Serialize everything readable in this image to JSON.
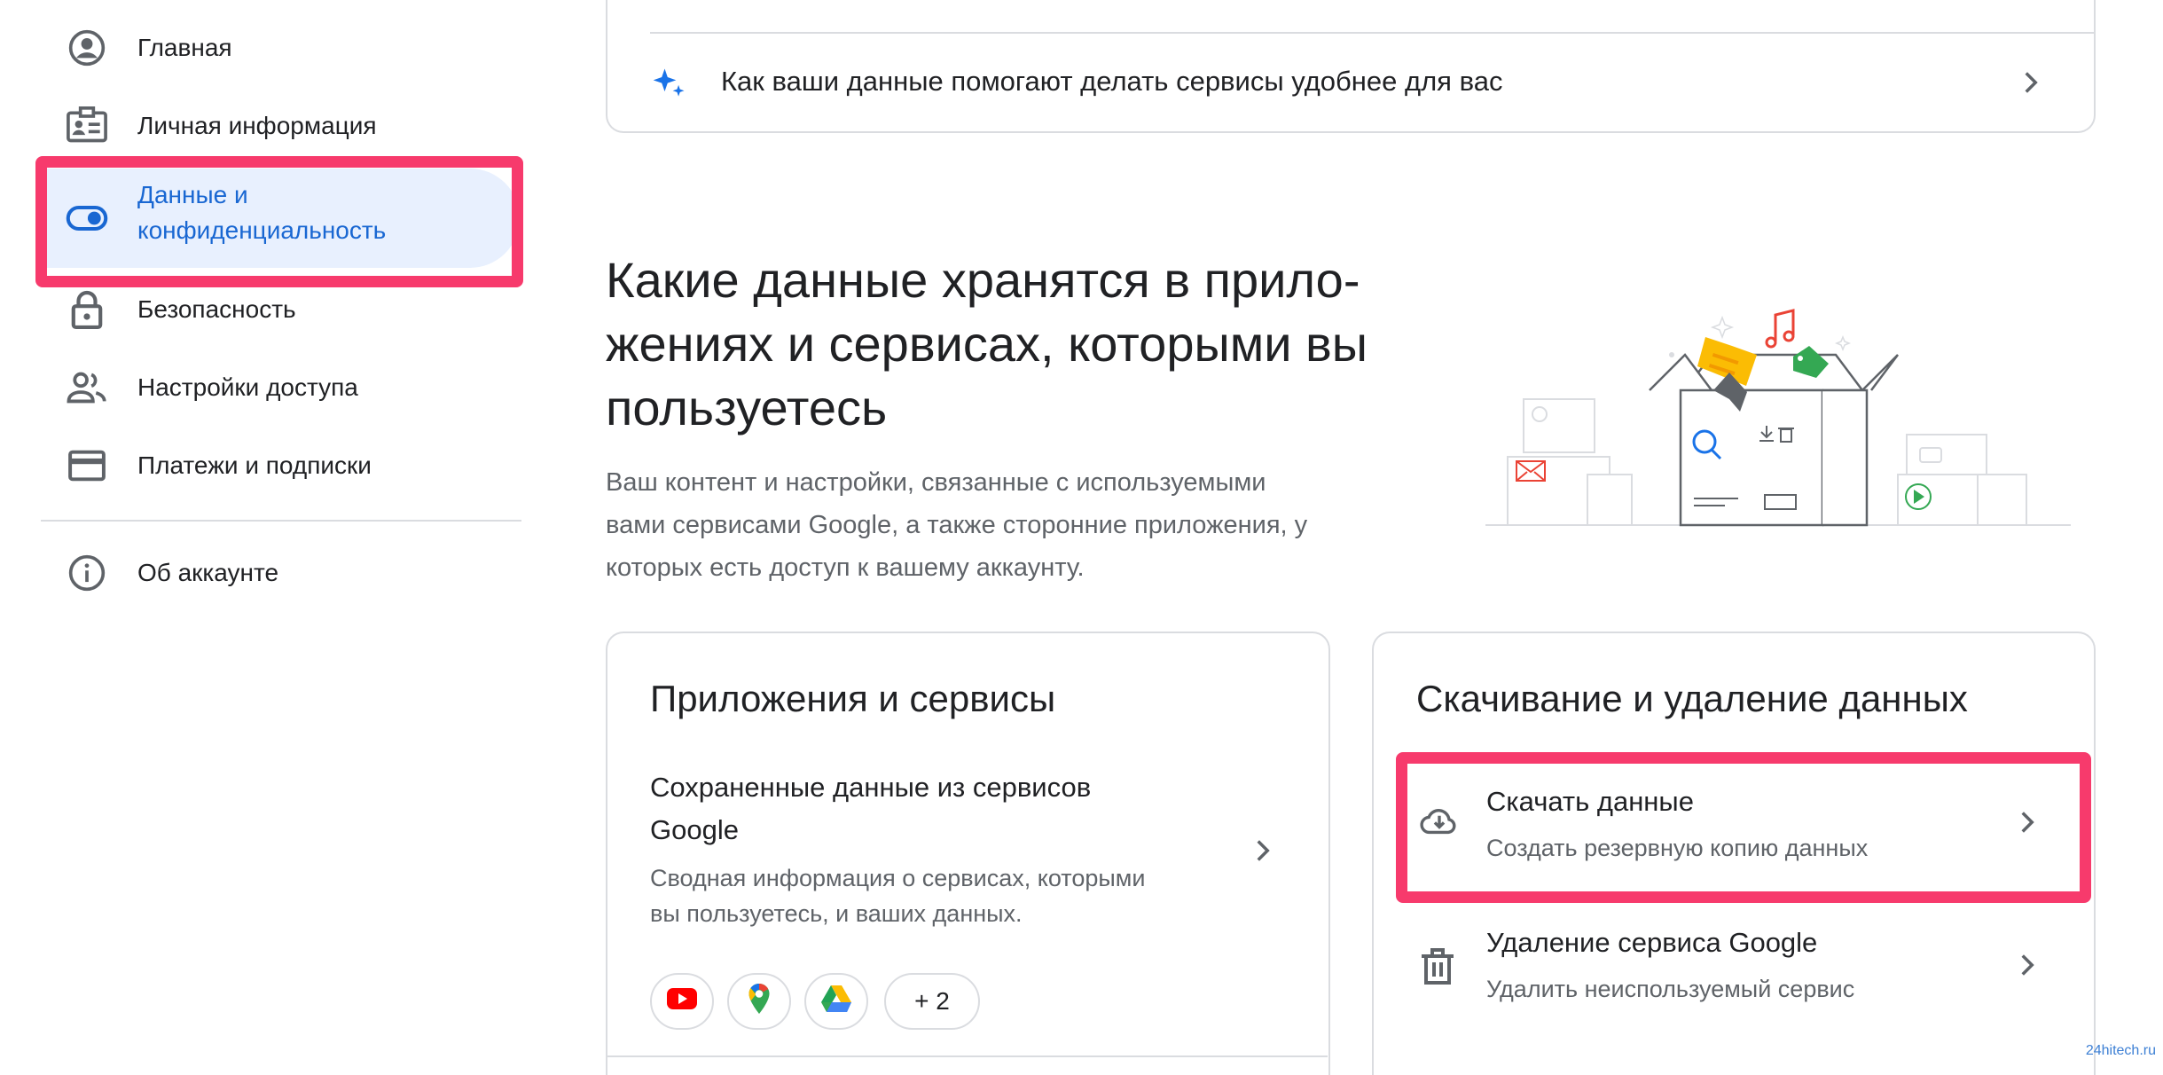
{
  "sidebar": {
    "items": [
      {
        "label": "Главная",
        "icon": "account-circle-icon"
      },
      {
        "label": "Личная информация",
        "icon": "badge-icon"
      },
      {
        "label": "Данные и конфиденциальность",
        "label_line1": "Данные и",
        "label_line2": "конфиденциальность",
        "icon": "toggle-icon",
        "active": true
      },
      {
        "label": "Безопасность",
        "icon": "lock-icon"
      },
      {
        "label": "Настройки доступа",
        "icon": "people-icon"
      },
      {
        "label": "Платежи и подписки",
        "icon": "credit-card-icon"
      }
    ],
    "about": {
      "label": "Об аккаунте",
      "icon": "info-icon"
    }
  },
  "top_card": {
    "link_text": "Как ваши данные помогают делать сервисы удобнее для вас",
    "icon": "sparkle-icon"
  },
  "section": {
    "title_line1": "Какие данные хранятся в прило-",
    "title_line2": "жениях и сервисах, которыми вы",
    "title_line3": "пользуетесь",
    "description_line1": "Ваш контент и настройки, связанные с используемыми",
    "description_line2": "вами сервисами Google, а также сторонние приложения, у",
    "description_line3": "которых есть доступ к вашему аккаунту."
  },
  "apps_card": {
    "title": "Приложения и сервисы",
    "item_title_line1": "Сохраненные данные из сервисов",
    "item_title_line2": "Google",
    "item_sub_line1": "Сводная информация о сервисах, которыми",
    "item_sub_line2": "вы пользуетесь, и ваших данных.",
    "chips": [
      "youtube-icon",
      "maps-icon",
      "drive-icon"
    ],
    "more_chip": "+ 2"
  },
  "download_card": {
    "title": "Скачивание и удаление данных",
    "items": [
      {
        "title": "Скачать данные",
        "subtitle": "Создать резервную копию данных",
        "icon": "cloud-download-icon"
      },
      {
        "title": "Удаление сервиса Google",
        "subtitle": "Удалить неиспользуемый сервис",
        "icon": "trash-icon"
      }
    ]
  },
  "watermark": "24hitech.ru",
  "colors": {
    "accent_blue": "#1967d2",
    "active_bg": "#e8f0fe",
    "highlight": "#f73a6c",
    "divider": "#dadce0",
    "secondary_text": "#5f6368"
  }
}
